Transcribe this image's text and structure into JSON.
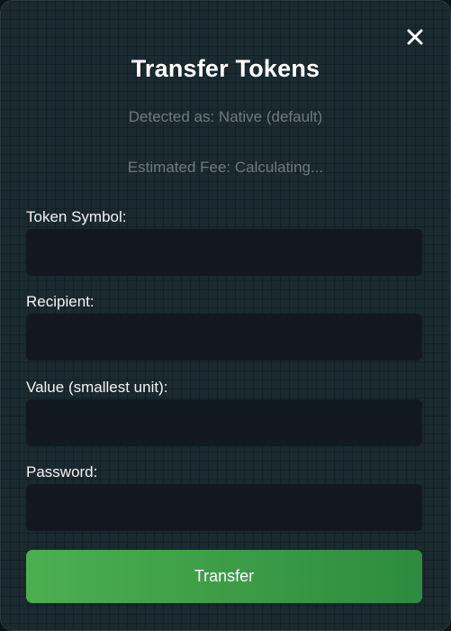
{
  "modal": {
    "title": "Transfer Tokens",
    "detected_text": "Detected as: Native (default)",
    "fee_text": "Estimated Fee: Calculating..."
  },
  "close_icon": "close-icon",
  "fields": {
    "token_symbol": {
      "label": "Token Symbol:",
      "value": "",
      "placeholder": ""
    },
    "recipient": {
      "label": "Recipient:",
      "value": "",
      "placeholder": ""
    },
    "value": {
      "label": "Value (smallest unit):",
      "value": "",
      "placeholder": ""
    },
    "password": {
      "label": "Password:",
      "value": "",
      "placeholder": ""
    }
  },
  "submit": {
    "label": "Transfer"
  },
  "colors": {
    "accent_start": "#4caf50",
    "accent_end": "#2e8b3e",
    "input_bg": "#111820",
    "panel_bg": "#1a2a30"
  }
}
